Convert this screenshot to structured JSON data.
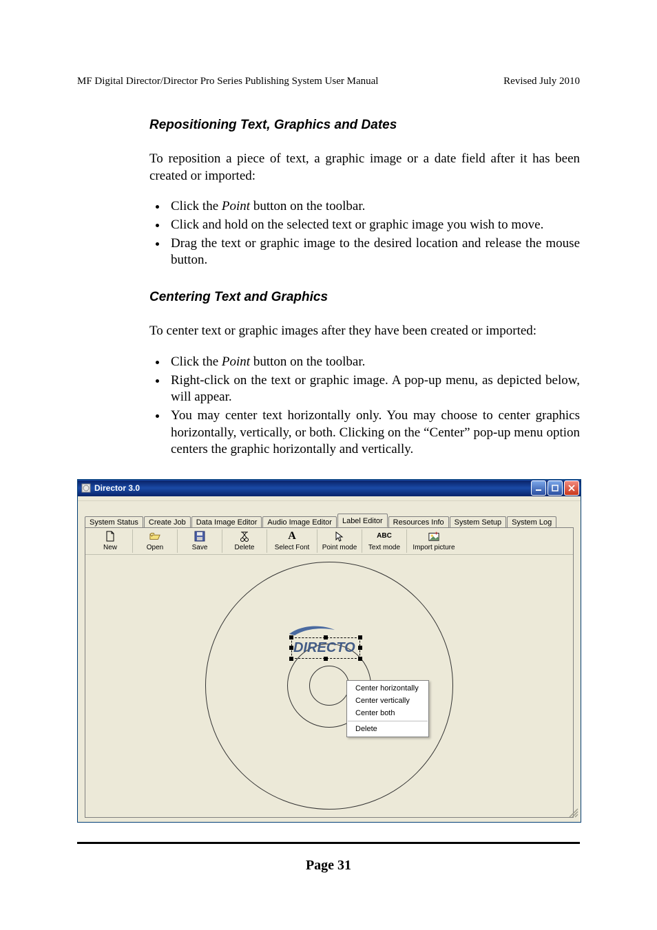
{
  "header": {
    "left": "MF Digital Director/Director Pro Series Publishing System User Manual",
    "right": "Revised July 2010"
  },
  "section1": {
    "heading": "Repositioning Text, Graphics and Dates",
    "intro": "To reposition a piece of text, a graphic image or a date field after it has been created or imported:",
    "bullets": {
      "b1_pre": "Click the ",
      "b1_italic": "Point",
      "b1_post": " button on the toolbar.",
      "b2": "Click and hold on the selected text or graphic image you wish to move.",
      "b3": "Drag the text or graphic image to the desired location and release the mouse button."
    }
  },
  "section2": {
    "heading": "Centering Text and Graphics",
    "intro": "To center text or graphic images after they have been created or imported:",
    "bullets": {
      "b1_pre": "Click the ",
      "b1_italic": "Point",
      "b1_post": " button on the toolbar.",
      "b2": "Right-click on the text or graphic image. A pop-up menu, as depicted below, will appear.",
      "b3": "You may center text horizontally only. You may choose to center graphics horizontally, vertically, or both. Clicking on the “Center” pop-up menu option centers the graphic horizontally and vertically."
    }
  },
  "app": {
    "title": "Director 3.0",
    "tabs": [
      "System Status",
      "Create Job",
      "Data Image Editor",
      "Audio Image Editor",
      "Label Editor",
      "Resources Info",
      "System Setup",
      "System Log"
    ],
    "active_tab": 4,
    "toolbar": [
      {
        "label": "New",
        "icon": "new-icon"
      },
      {
        "label": "Open",
        "icon": "open-icon"
      },
      {
        "label": "Save",
        "icon": "save-icon"
      },
      {
        "label": "Delete",
        "icon": "delete-icon"
      },
      {
        "label": "Select Font",
        "icon": "font-icon"
      },
      {
        "label": "Point mode",
        "icon": "pointer-icon"
      },
      {
        "label": "Text mode",
        "icon": "text-mode-icon"
      },
      {
        "label": "Import picture",
        "icon": "import-picture-icon"
      }
    ],
    "label_text": "DIRECTO",
    "popup": {
      "items": [
        "Center horizontally",
        "Center vertically",
        "Center both"
      ],
      "delete": "Delete"
    }
  },
  "page_number": "Page 31"
}
